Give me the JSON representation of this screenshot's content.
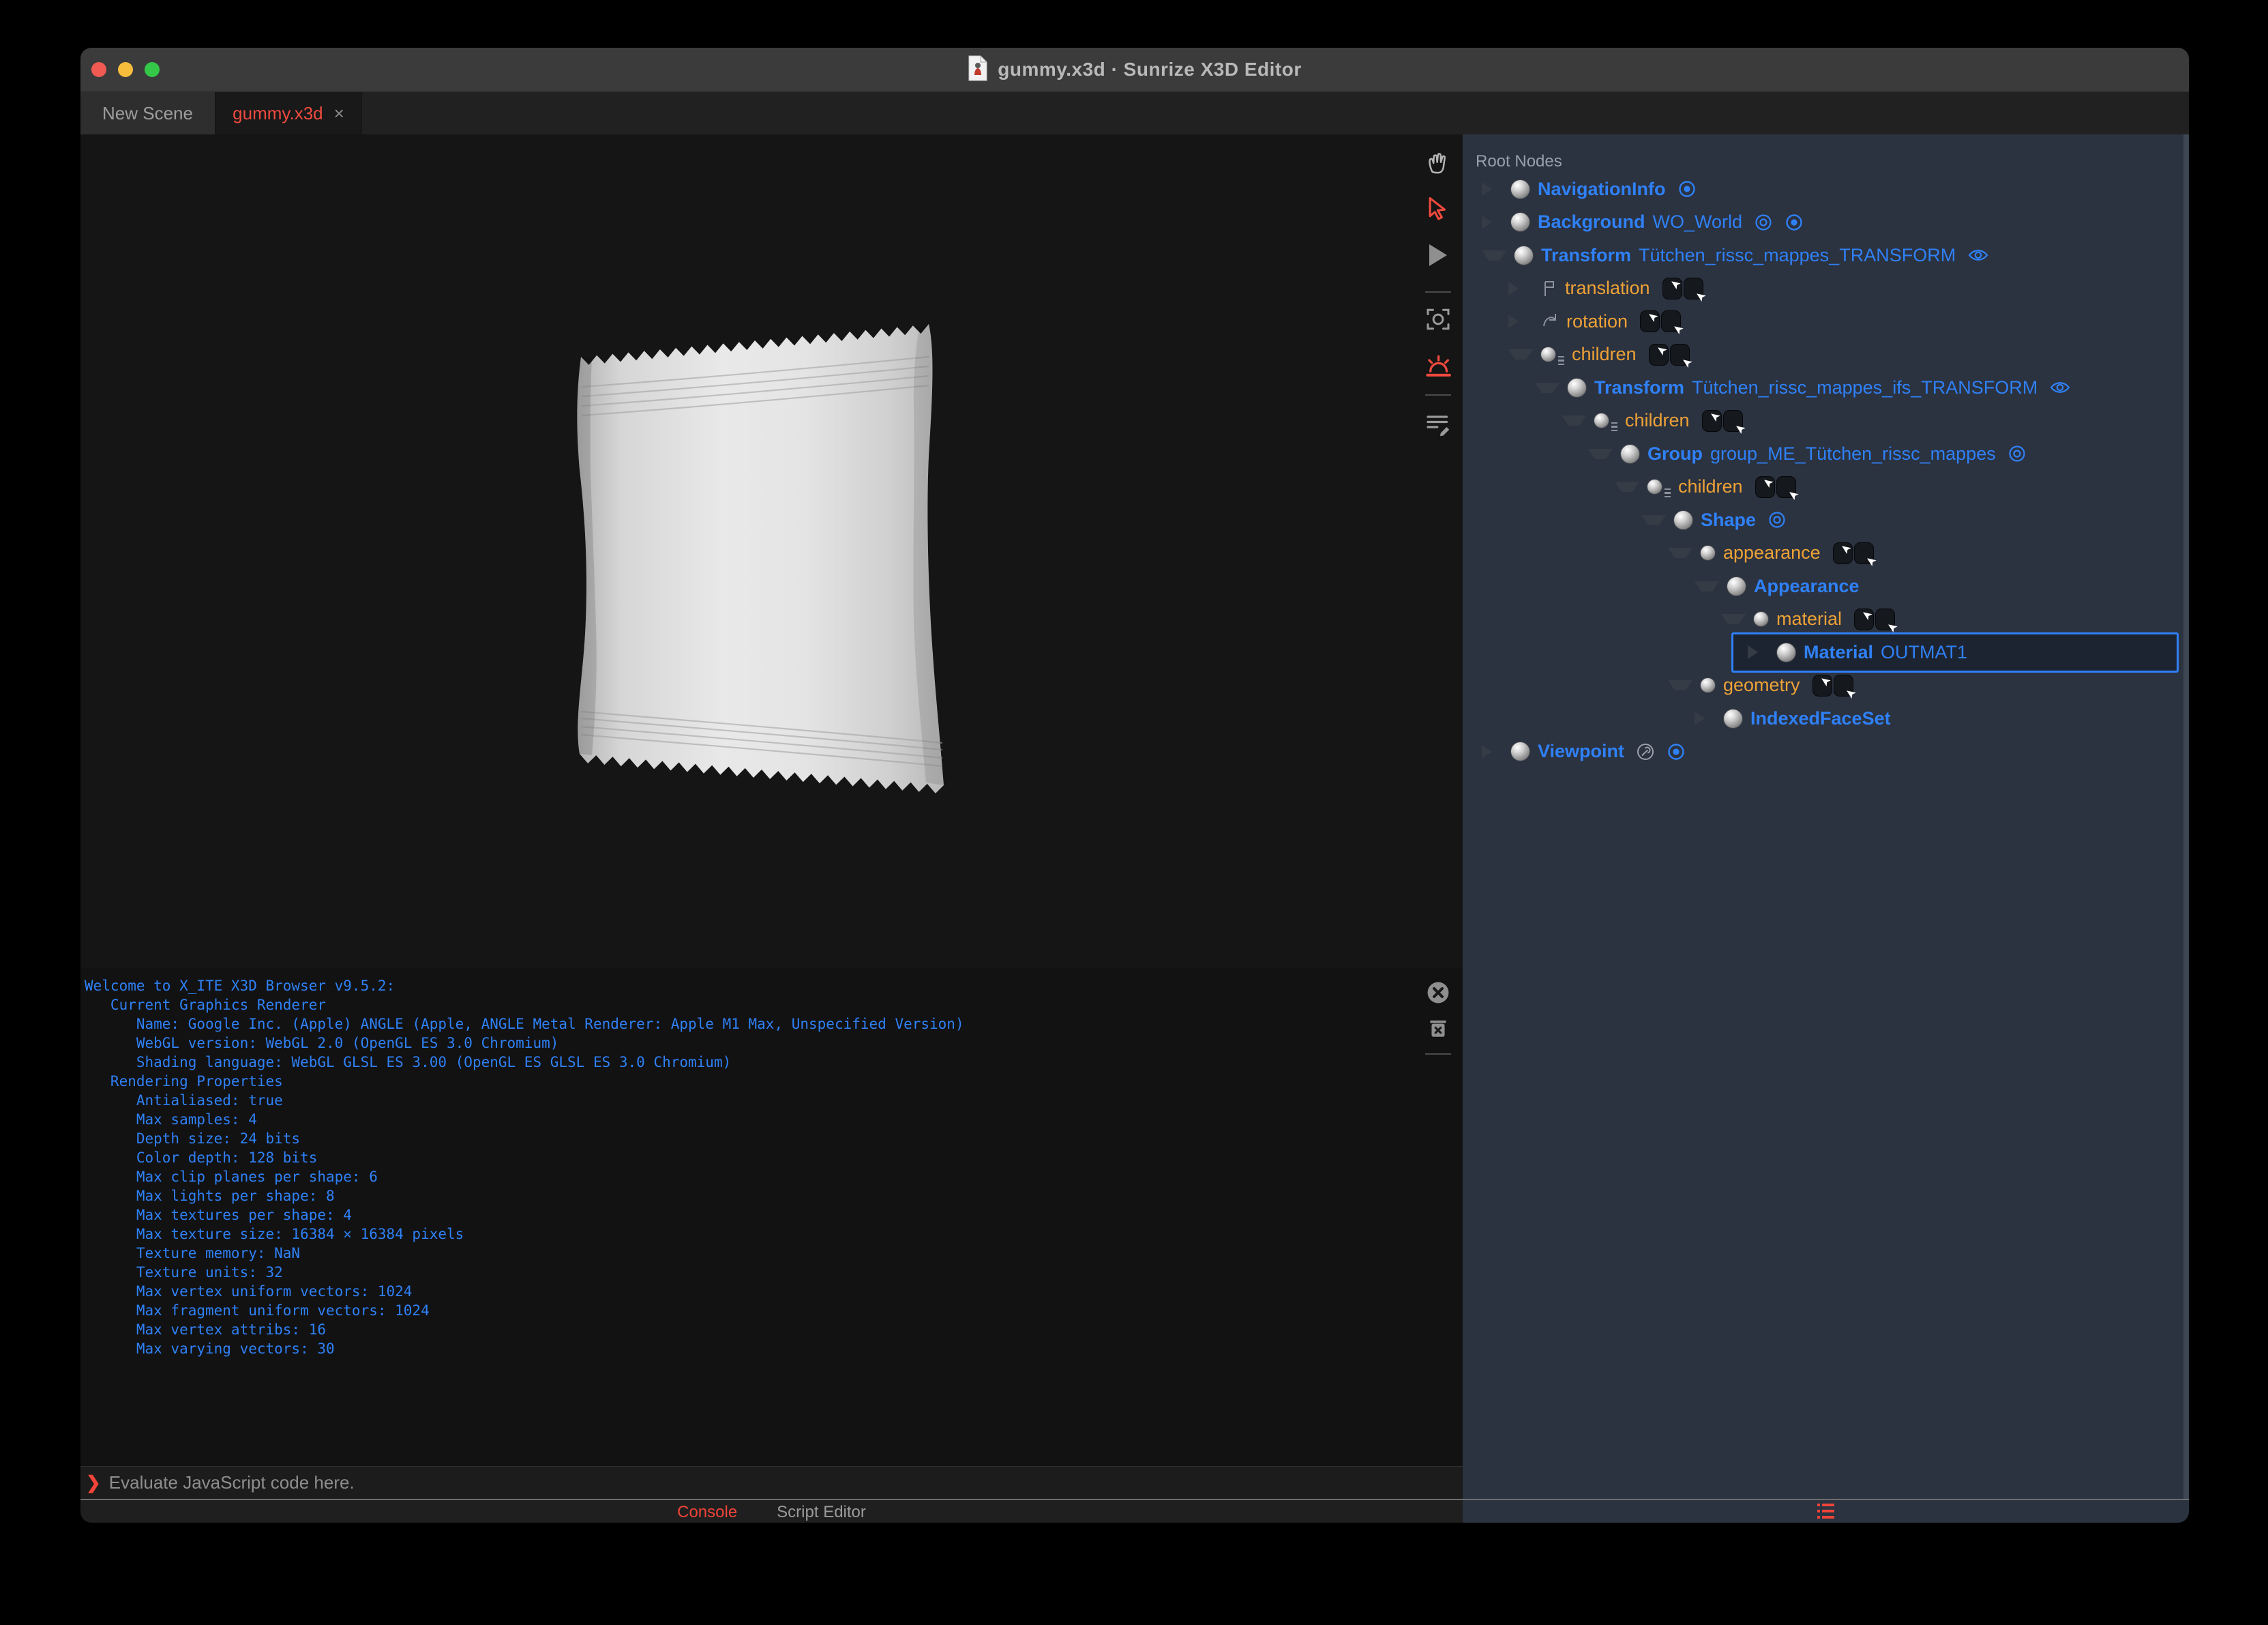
{
  "window": {
    "title": "gummy.x3d · Sunrize X3D Editor",
    "traffic_lights": [
      "close-button",
      "minimize-button",
      "zoom-button"
    ]
  },
  "tabs": [
    {
      "label": "New Scene",
      "active": false,
      "close": ""
    },
    {
      "label": "gummy.x3d",
      "active": true,
      "close": "×"
    }
  ],
  "toolbar_icons": [
    "hand-tool-icon",
    "select-arrow-icon",
    "play-icon",
    "screenshot-icon",
    "light-icon",
    "script-lines-icon"
  ],
  "console_toolbar_icons": [
    "dismiss-circle-icon",
    "clear-console-icon"
  ],
  "colors": {
    "accent_red": "#f04438",
    "node_blue": "#2f81f7",
    "field_orange": "#eea236",
    "panel_bg": "#2b3240",
    "console_text": "#2f81f7"
  },
  "outline": {
    "header": "Root Nodes",
    "rows": [
      {
        "indent": 0,
        "exp": "closed",
        "icon": "node",
        "kind": "node",
        "type": "NavigationInfo",
        "name": "",
        "trail": [
          "bind"
        ]
      },
      {
        "indent": 0,
        "exp": "closed",
        "icon": "node",
        "kind": "node",
        "type": "Background",
        "name": "WO_World",
        "trail": [
          "ring",
          "bind"
        ]
      },
      {
        "indent": 0,
        "exp": "open",
        "icon": "node",
        "kind": "node",
        "type": "Transform",
        "name": "Tütchen_rissc_mappes_TRANSFORM",
        "trail": [
          "eye"
        ]
      },
      {
        "indent": 1,
        "exp": "closed",
        "icon": "translation",
        "kind": "field",
        "type": "translation",
        "name": "",
        "trail": [
          "routes"
        ]
      },
      {
        "indent": 1,
        "exp": "closed",
        "icon": "rotation",
        "kind": "field",
        "type": "rotation",
        "name": "",
        "trail": [
          "routes"
        ]
      },
      {
        "indent": 1,
        "exp": "open",
        "icon": "mfnode",
        "kind": "field",
        "type": "children",
        "name": "",
        "trail": [
          "routes"
        ]
      },
      {
        "indent": 2,
        "exp": "open",
        "icon": "node",
        "kind": "node",
        "type": "Transform",
        "name": "Tütchen_rissc_mappes_ifs_TRANSFORM",
        "trail": [
          "eye"
        ]
      },
      {
        "indent": 3,
        "exp": "open",
        "icon": "mfnode",
        "kind": "field",
        "type": "children",
        "name": "",
        "trail": [
          "routes"
        ]
      },
      {
        "indent": 4,
        "exp": "open",
        "icon": "node",
        "kind": "node",
        "type": "Group",
        "name": "group_ME_Tütchen_rissc_mappes",
        "trail": [
          "ring"
        ]
      },
      {
        "indent": 5,
        "exp": "open",
        "icon": "mfnode",
        "kind": "field",
        "type": "children",
        "name": "",
        "trail": [
          "routes"
        ]
      },
      {
        "indent": 6,
        "exp": "open",
        "icon": "node",
        "kind": "node",
        "type": "Shape",
        "name": "",
        "trail": [
          "ring"
        ]
      },
      {
        "indent": 7,
        "exp": "open",
        "icon": "sfnode",
        "kind": "field",
        "type": "appearance",
        "name": "",
        "trail": [
          "routes"
        ]
      },
      {
        "indent": 8,
        "exp": "open",
        "icon": "node",
        "kind": "node",
        "type": "Appearance",
        "name": "",
        "trail": []
      },
      {
        "indent": 9,
        "exp": "open",
        "icon": "sfnode",
        "kind": "field",
        "type": "material",
        "name": "",
        "trail": [
          "routes"
        ]
      },
      {
        "indent": 10,
        "exp": "closed",
        "icon": "node",
        "kind": "node",
        "type": "Material",
        "name": "OUTMAT1",
        "trail": [],
        "selected": true
      },
      {
        "indent": 7,
        "exp": "open",
        "icon": "sfnode",
        "kind": "field",
        "type": "geometry",
        "name": "",
        "trail": [
          "routes"
        ]
      },
      {
        "indent": 8,
        "exp": "closed",
        "icon": "node",
        "kind": "node",
        "type": "IndexedFaceSet",
        "name": "",
        "trail": []
      },
      {
        "indent": 0,
        "exp": "closed",
        "icon": "node",
        "kind": "node",
        "type": "Viewpoint",
        "name": "",
        "trail": [
          "wrench",
          "bind"
        ]
      }
    ]
  },
  "console": {
    "lines": [
      "Welcome to X_ITE X3D Browser v9.5.2:",
      "   Current Graphics Renderer",
      "      Name: Google Inc. (Apple) ANGLE (Apple, ANGLE Metal Renderer: Apple M1 Max, Unspecified Version)",
      "      WebGL version: WebGL 2.0 (OpenGL ES 3.0 Chromium)",
      "      Shading language: WebGL GLSL ES 3.00 (OpenGL ES GLSL ES 3.0 Chromium)",
      "   Rendering Properties",
      "      Antialiased: true",
      "      Max samples: 4",
      "      Depth size: 24 bits",
      "      Color depth: 128 bits",
      "      Max clip planes per shape: 6",
      "      Max lights per shape: 8",
      "      Max textures per shape: 4",
      "      Max texture size: 16384 × 16384 pixels",
      "      Texture memory: NaN",
      "      Texture units: 32",
      "      Max vertex uniform vectors: 1024",
      "      Max fragment uniform vectors: 1024",
      "      Max vertex attribs: 16",
      "      Max varying vectors: 30"
    ]
  },
  "prompt": {
    "chevron": "❯",
    "placeholder": "Evaluate JavaScript code here."
  },
  "footer": {
    "console_label": "Console",
    "script_editor_label": "Script Editor"
  }
}
